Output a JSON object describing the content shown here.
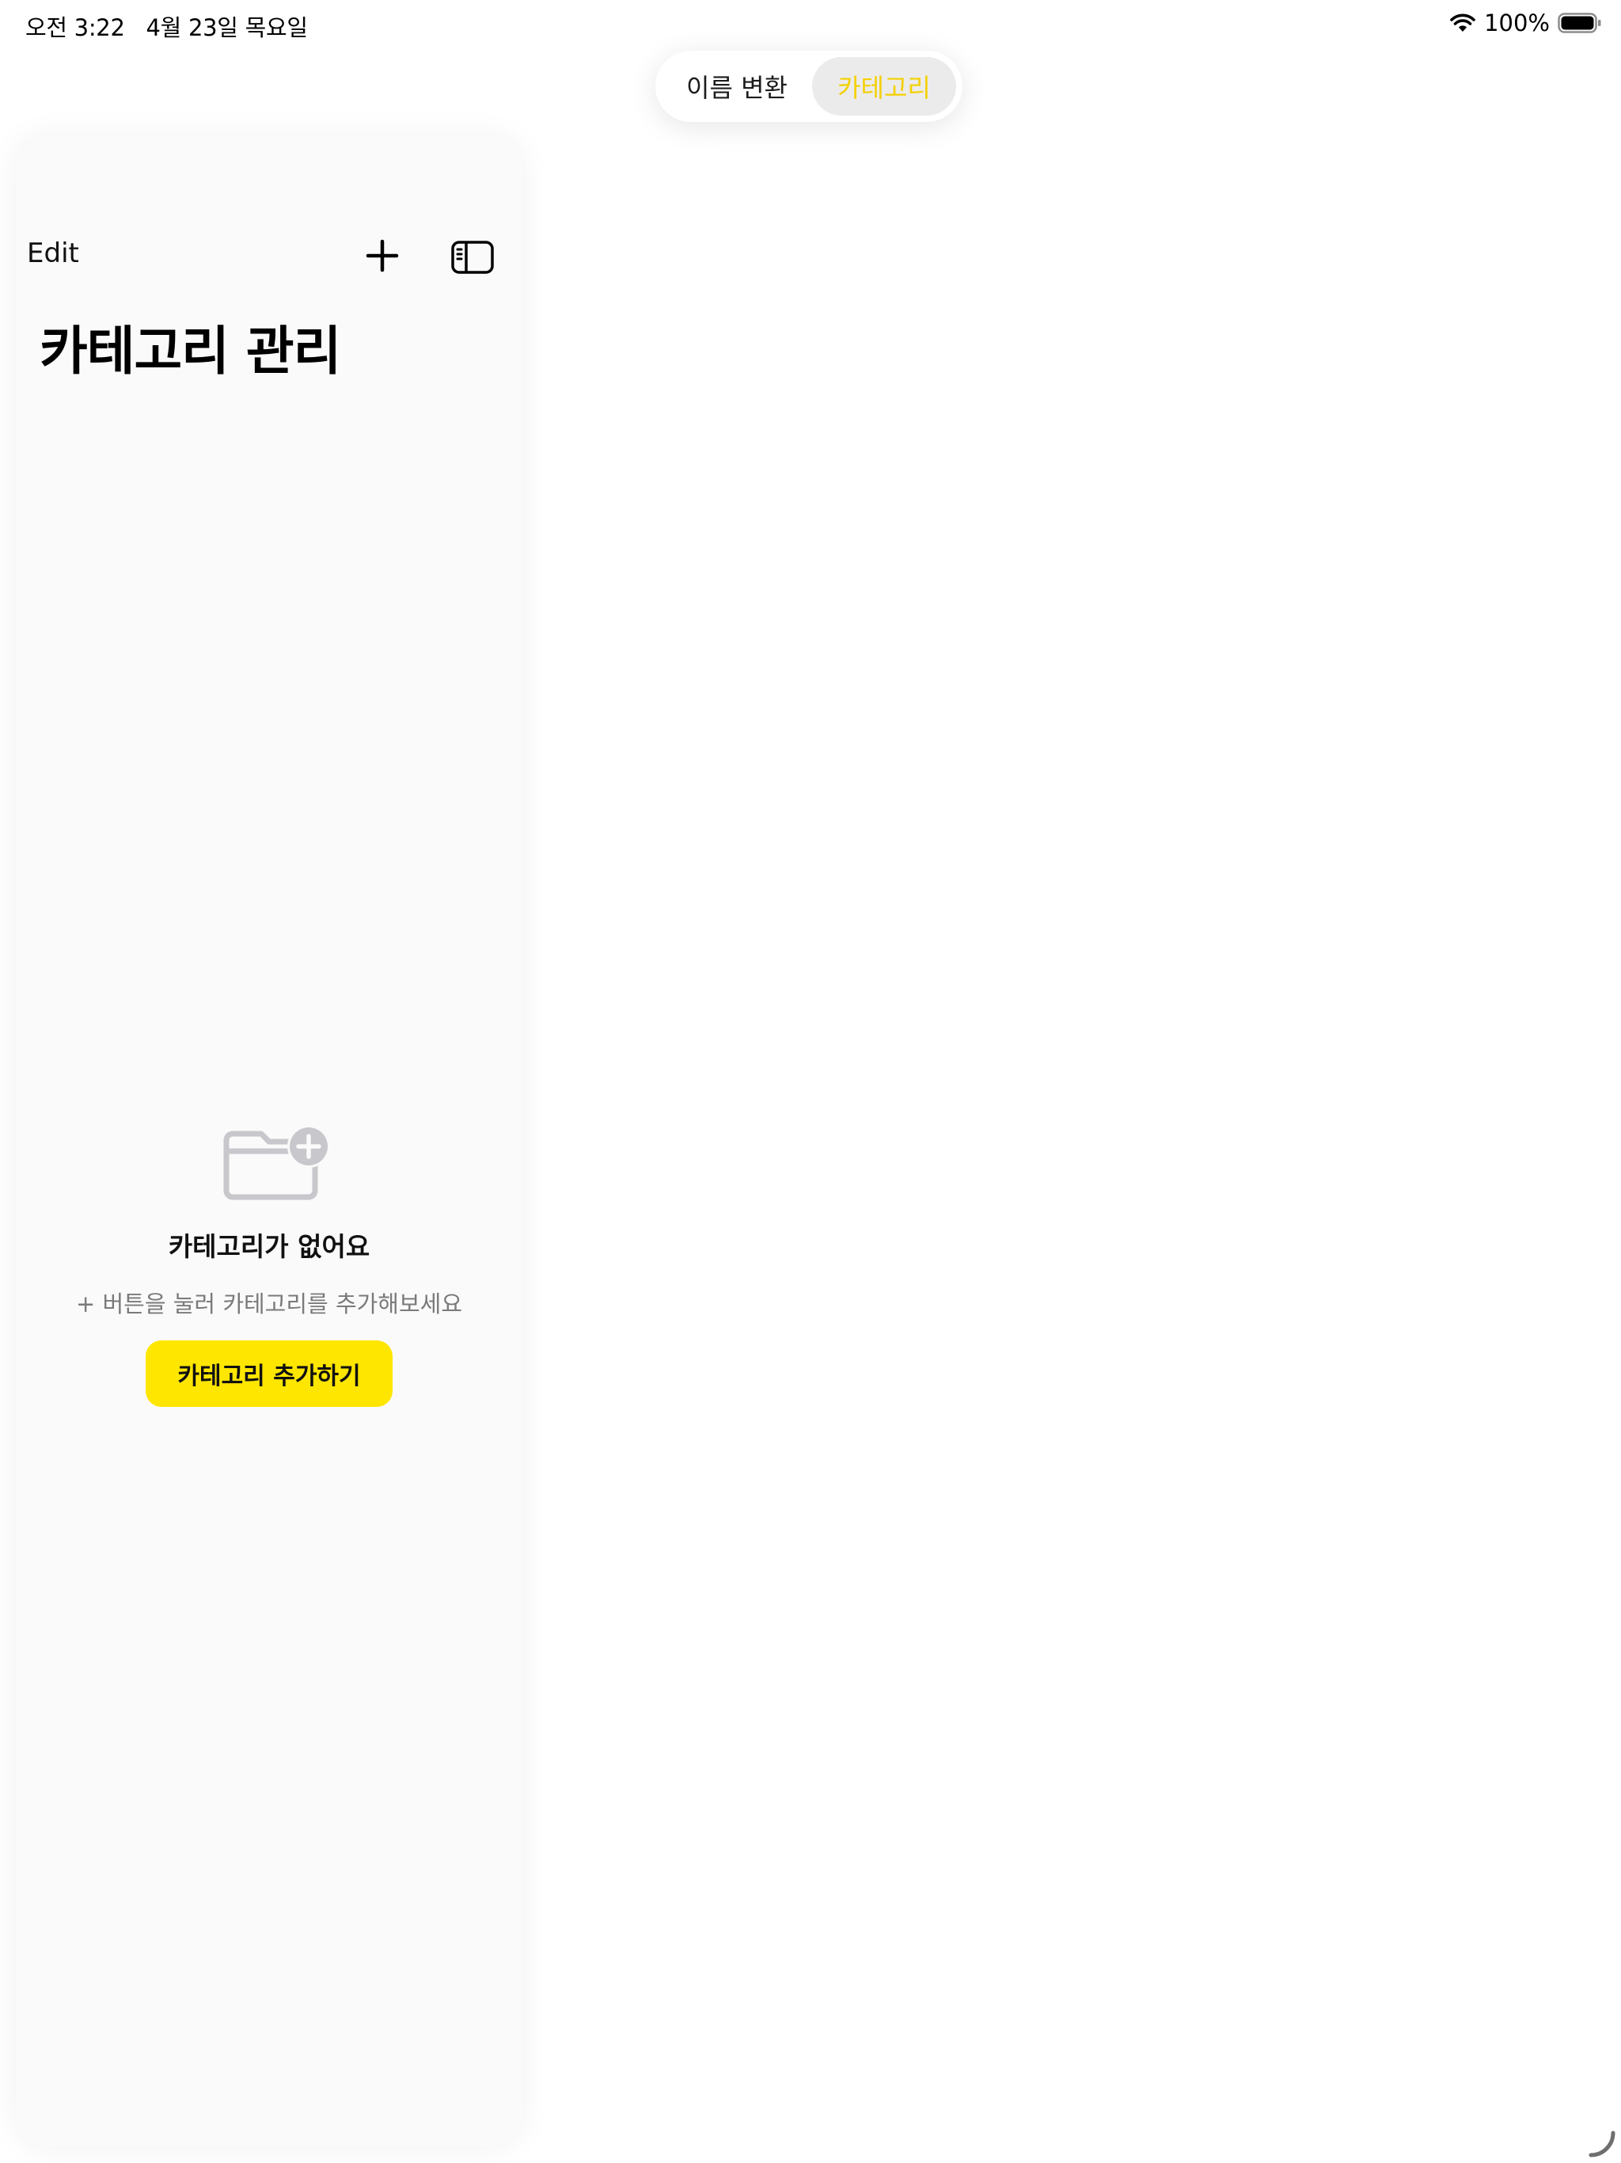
{
  "status_bar": {
    "time": "오전 3:22",
    "date": "4월 23일 목요일",
    "battery_percent": "100%",
    "icons": [
      "wifi-icon",
      "battery-icon"
    ]
  },
  "segmented": {
    "tabs": [
      {
        "label": "이름 변환",
        "selected": false
      },
      {
        "label": "카테고리",
        "selected": true
      }
    ],
    "selected_color": "#f4d000"
  },
  "sidebar": {
    "edit_label": "Edit",
    "icons": [
      "plus-icon",
      "sidebar-toggle-icon"
    ],
    "title": "카테고리 관리"
  },
  "empty_state": {
    "icon": "folder-plus-icon",
    "title": "카테고리가 없어요",
    "subtitle": "+ 버튼을 눌러 카테고리를 추가해보세요",
    "button_label": "카테고리 추가하기",
    "button_color": "#ffe600"
  }
}
